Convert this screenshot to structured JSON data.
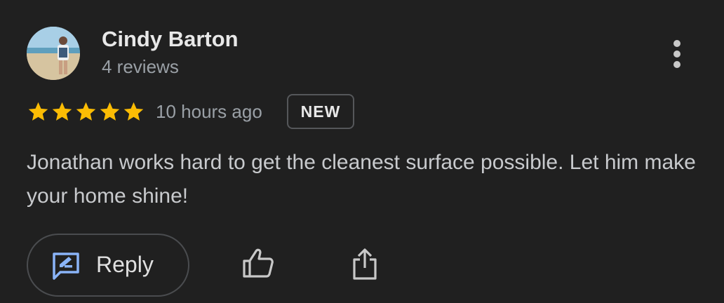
{
  "review": {
    "author_name": "Cindy Barton",
    "author_reviews": "4 reviews",
    "rating": 5,
    "rating_max": 5,
    "time_ago": "10 hours ago",
    "badge": "NEW",
    "text": "Jonathan works hard to get the cleanest surface possible. Let him make your home shine!"
  },
  "actions": {
    "reply_label": "Reply",
    "reply_icon": "rate-review-icon",
    "like_icon": "thumb-up-icon",
    "share_icon": "share-icon",
    "more_icon": "more-vert-icon"
  },
  "colors": {
    "background": "#202020",
    "star": "#FBBC04",
    "reply_icon": "#8AB4F8"
  }
}
